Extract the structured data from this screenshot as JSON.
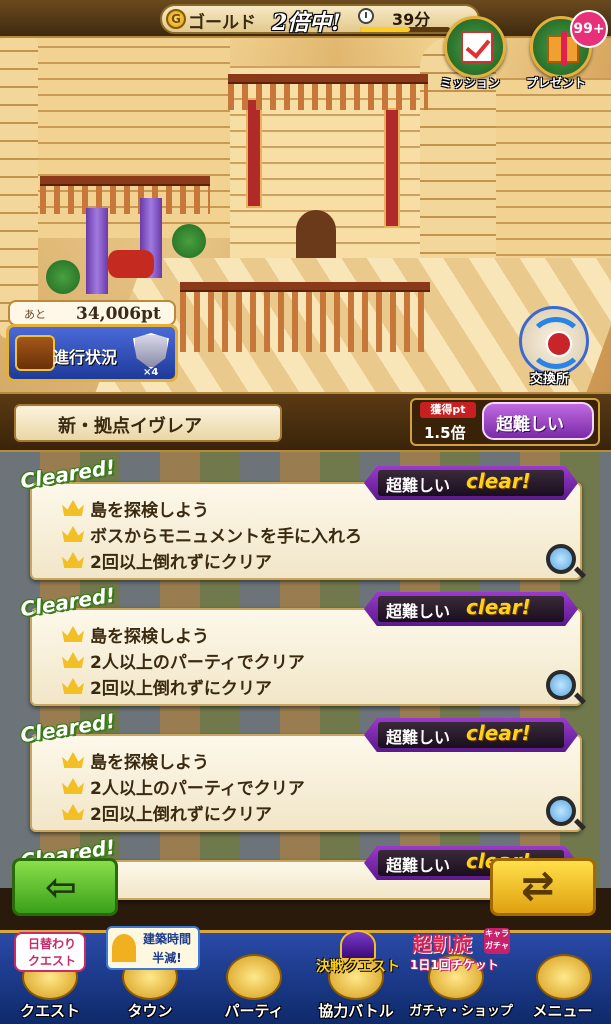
{
  "header": {
    "gold_icon": "G",
    "gold_label": "ゴールド",
    "multiplier": "2倍中!",
    "time_left": "39分",
    "time_progress": 0.55
  },
  "scene": {
    "mission_label": "ミッション",
    "present_label": "プレゼント",
    "present_badge": "99+",
    "exchange_label": "交換所",
    "remain_prefix": "あと",
    "remain_value": "34,006pt",
    "progress_label": "進行状況",
    "item_count": "×4"
  },
  "stage": {
    "title": "新・拠点イヴレア",
    "pt_label": "獲得pt",
    "pt_value": "1.5倍",
    "difficulty": "超難しい"
  },
  "quests": [
    {
      "cleared": "Cleared!",
      "difficulty": "超難しい",
      "status": "clear!",
      "objectives": [
        "島を探検しよう",
        "ボスからモニュメントを手に入れろ",
        "2回以上倒れずにクリア"
      ]
    },
    {
      "cleared": "Cleared!",
      "difficulty": "超難しい",
      "status": "clear!",
      "objectives": [
        "島を探検しよう",
        "2人以上のパーティでクリア",
        "2回以上倒れずにクリア"
      ]
    },
    {
      "cleared": "Cleared!",
      "difficulty": "超難しい",
      "status": "clear!",
      "objectives": [
        "島を探検しよう",
        "2人以上のパーティでクリア",
        "2回以上倒れずにクリア"
      ]
    },
    {
      "cleared": "Cleared!",
      "difficulty": "超難しい",
      "status": "clear!",
      "objectives": []
    }
  ],
  "controls": {
    "back_glyph": "⇦",
    "cycle_glyph": "⇄"
  },
  "badges": {
    "daily_line1": "日替わり",
    "daily_line2": "クエスト",
    "build_line1": "建築時間",
    "build_line2": "半減!",
    "decide": "決戦クエスト",
    "gacha_top": "超凱旋",
    "gacha_side": "キャラガチャ",
    "gacha_bottom": "1日1回チケット"
  },
  "nav": [
    {
      "label": "クエスト"
    },
    {
      "label": "タウン"
    },
    {
      "label": "パーティ"
    },
    {
      "label": "協力バトル"
    },
    {
      "label": "ガチャ・ショップ"
    },
    {
      "label": "メニュー"
    }
  ]
}
